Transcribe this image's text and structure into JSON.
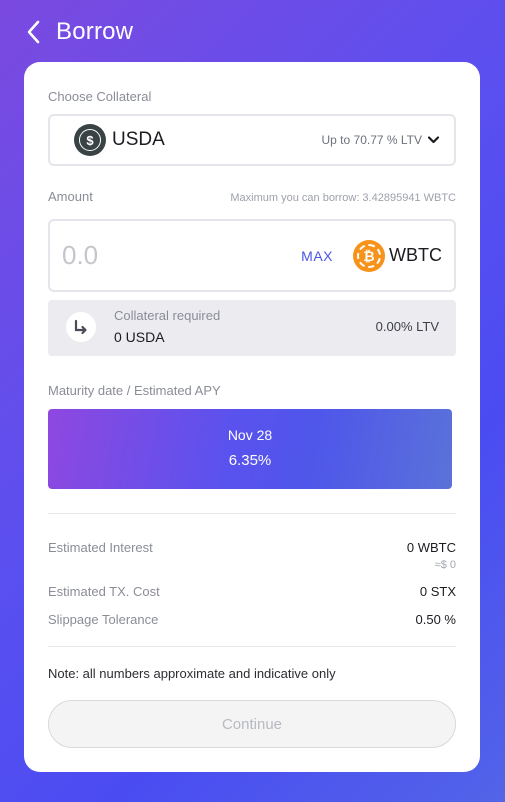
{
  "header": {
    "title": "Borrow"
  },
  "collateral": {
    "label": "Choose Collateral",
    "asset": "USDA",
    "usda_glyph": "$",
    "ltv_info": "Up to 70.77 % LTV"
  },
  "amount": {
    "label": "Amount",
    "max_borrow": "Maximum you can borrow: 3.42895941 WBTC",
    "placeholder": "0.0",
    "max_label": "MAX",
    "asset": "WBTC",
    "btc_glyph": "₿"
  },
  "collateral_required": {
    "label": "Collateral required",
    "value": "0 USDA",
    "ltv": "0.00% LTV"
  },
  "maturity": {
    "label": "Maturity date / Estimated APY",
    "date": "Nov 28",
    "apy": "6.35%"
  },
  "summary": {
    "interest_label": "Estimated Interest",
    "interest_value": "0 WBTC",
    "interest_usd": "≈$ 0",
    "tx_cost_label": "Estimated TX. Cost",
    "tx_cost_value": "0 STX",
    "slippage_label": "Slippage Tolerance",
    "slippage_value": "0.50 %"
  },
  "note": "Note: all numbers approximate and indicative only",
  "continue_label": "Continue",
  "colors": {
    "accent": "#4a54e8",
    "usda_coin": "#3a4344",
    "wbtc_coin": "#f7931a"
  },
  "icons": {
    "back": "chevron-left-icon",
    "dropdown": "chevron-down-icon",
    "collateral_arrow": "return-arrow-icon"
  }
}
